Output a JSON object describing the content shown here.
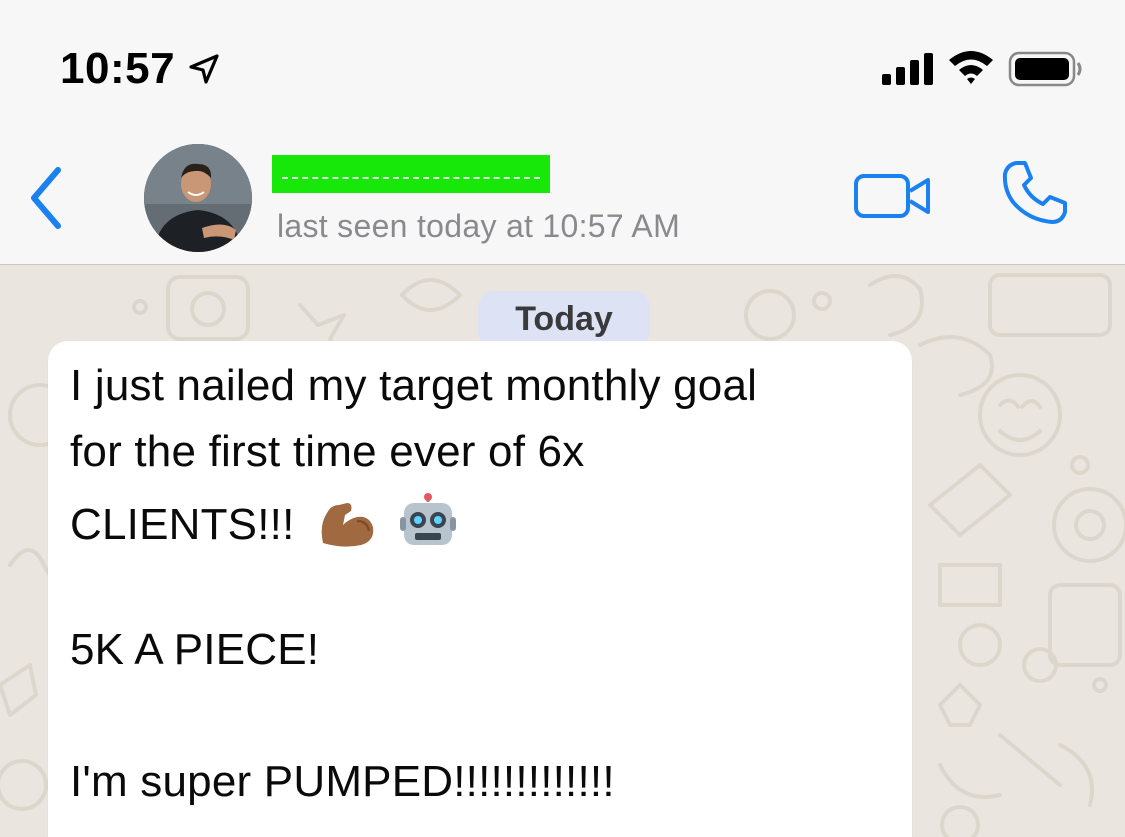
{
  "status_bar": {
    "time": "10:57",
    "icons": [
      "location-arrow-icon",
      "cellular-signal-icon",
      "wifi-icon",
      "battery-icon"
    ]
  },
  "header": {
    "back_icon": "chevron-left-icon",
    "contact_name": "",
    "last_seen": "last seen today at 10:57 AM",
    "actions": [
      "video-camera-icon",
      "phone-icon"
    ],
    "accent_color": "#1a82f0",
    "name_redaction_color": "#17e80a"
  },
  "chat": {
    "date_label": "Today",
    "message": {
      "lines": [
        "I just nailed my target monthly goal",
        "for the first time ever of 6x",
        "CLIENTS!!!",
        "",
        "5K A PIECE!",
        "",
        "I'm super PUMPED!!!!!!!!!!!!!"
      ],
      "emojis": [
        "flexed-biceps-emoji",
        "robot-emoji"
      ]
    },
    "wallpaper_color": "#eae6df",
    "date_chip_color": "#dde3f5"
  }
}
